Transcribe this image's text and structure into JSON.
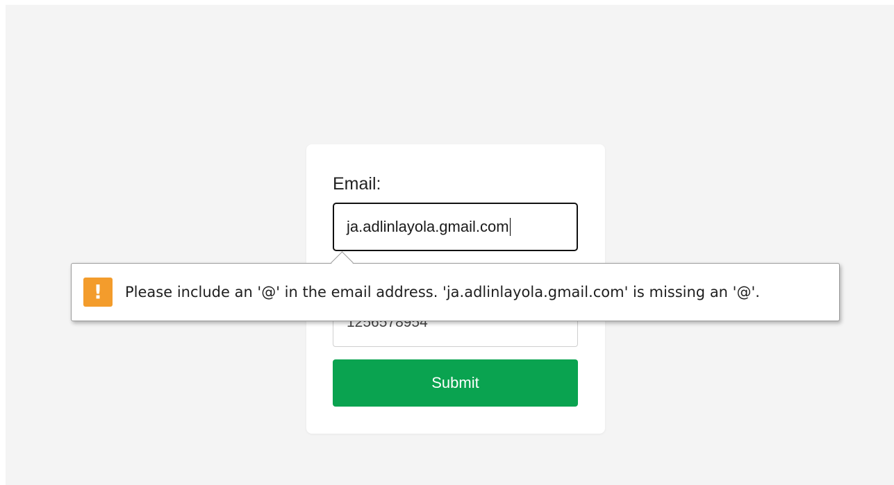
{
  "form": {
    "email_label": "Email:",
    "email_value": "ja.adlinlayola.gmail.com",
    "phone_value": "1256578954",
    "submit_label": "Submit"
  },
  "validation_tooltip": {
    "icon": "warning-icon",
    "icon_glyph": "!",
    "message": "Please include an '@' in the email address. 'ja.adlinlayola.gmail.com' is missing an '@'."
  },
  "colors": {
    "page_background": "#f4f4f4",
    "card_background": "#ffffff",
    "submit_background": "#0aa350",
    "warning_icon": "#f39c2c"
  }
}
